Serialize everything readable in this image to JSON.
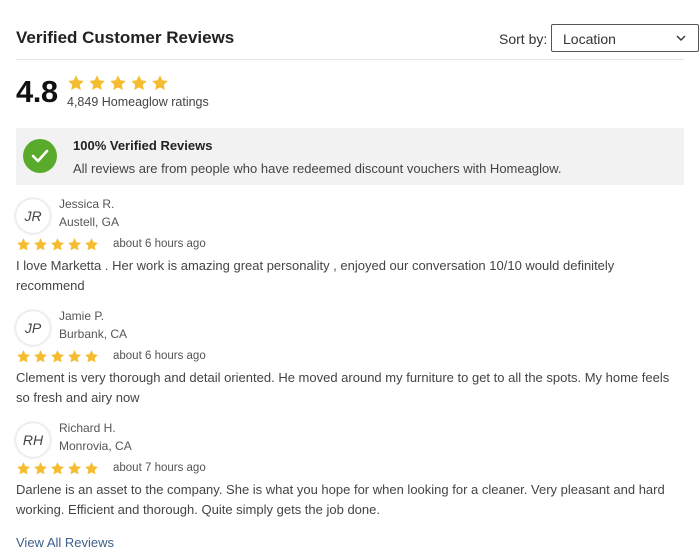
{
  "header": {
    "title": "Verified Customer Reviews",
    "sort_label": "Sort by:",
    "sort_value": "Location"
  },
  "summary": {
    "rating": "4.8",
    "stars": 5,
    "ratings_count": "4,849 Homeaglow ratings"
  },
  "verified": {
    "title": "100% Verified Reviews",
    "description": "All reviews are from people who have redeemed discount vouchers with Homeaglow."
  },
  "reviews": [
    {
      "initials": "JR",
      "name": "Jessica R.",
      "location": "Austell, GA",
      "stars": 5,
      "time": "about 6 hours ago",
      "text": "I love Marketta . Her work is amazing great personality , enjoyed our conversation 10/10 would definitely recommend"
    },
    {
      "initials": "JP",
      "name": "Jamie P.",
      "location": "Burbank, CA",
      "stars": 5,
      "time": "about 6 hours ago",
      "text": "Clement is very thorough and detail oriented. He moved around my furniture to get to all the spots. My home feels so fresh and airy now"
    },
    {
      "initials": "RH",
      "name": "Richard H.",
      "location": "Monrovia, CA",
      "stars": 5,
      "time": "about 7 hours ago",
      "text": "Darlene is an asset to the company. She is what you hope for when looking for a cleaner. Very pleasant and hard working. Efficient and thorough. Quite simply gets the job done."
    }
  ],
  "footer": {
    "view_all": "View All Reviews"
  },
  "colors": {
    "star": "#f6bc2f",
    "check": "#5aab2c",
    "link": "#3d5f8a"
  },
  "icons": {
    "star": "star-icon",
    "check": "check-icon",
    "chevron": "chevron-down-icon"
  }
}
